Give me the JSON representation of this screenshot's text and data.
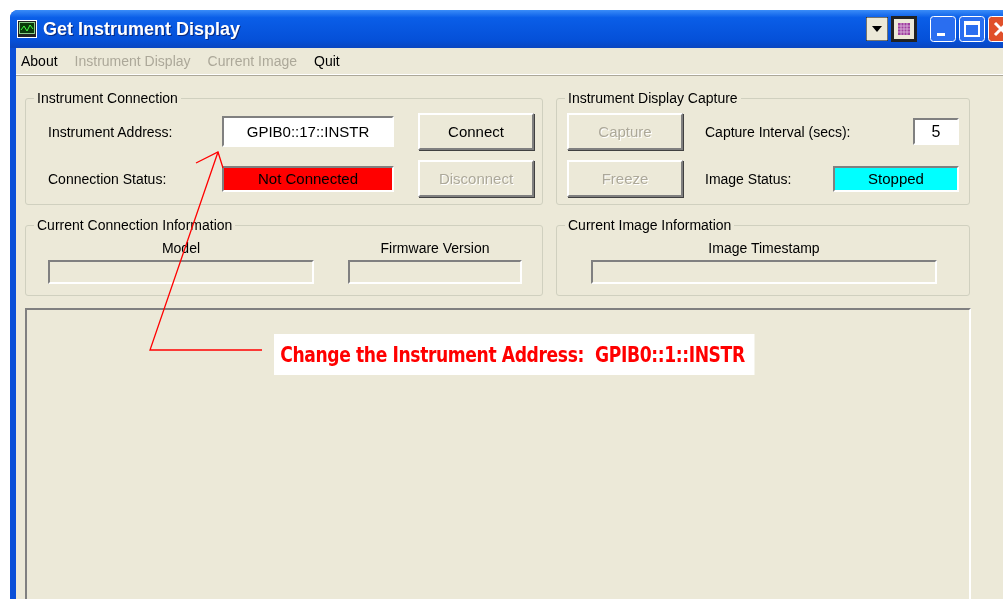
{
  "window": {
    "title": "Get Instrument Display"
  },
  "menu": [
    {
      "label": "About",
      "disabled": false
    },
    {
      "label": "Instrument Display",
      "disabled": true
    },
    {
      "label": "Current Image",
      "disabled": true
    },
    {
      "label": "Quit",
      "disabled": false
    }
  ],
  "instrument_connection": {
    "title": "Instrument Connection",
    "address_label": "Instrument Address:",
    "address_value": "GPIB0::17::INSTR",
    "status_label": "Connection Status:",
    "status": {
      "value": "Not Connected",
      "color": "#ff0000"
    },
    "buttons": [
      {
        "label": "Connect",
        "disabled": false
      },
      {
        "label": "Disconnect",
        "disabled": true
      }
    ]
  },
  "display_capture": {
    "title": "Instrument Display Capture",
    "buttons": [
      {
        "label": "Capture",
        "disabled": true
      },
      {
        "label": "Freeze",
        "disabled": true
      }
    ],
    "interval_label": "Capture Interval (secs):",
    "interval_value": "5",
    "status_label": "Image Status:",
    "status": {
      "value": "Stopped",
      "color": "#00ffff"
    }
  },
  "connection_info": {
    "title": "Current Connection Information",
    "fields": [
      {
        "label": "Model"
      },
      {
        "label": "Firmware Version"
      }
    ]
  },
  "image_info": {
    "title": "Current Image Information",
    "fields": [
      {
        "label": "Image Timestamp"
      }
    ]
  },
  "annotation": {
    "text": "Change the Instrument Address:  GPIB0::1::INSTR"
  }
}
